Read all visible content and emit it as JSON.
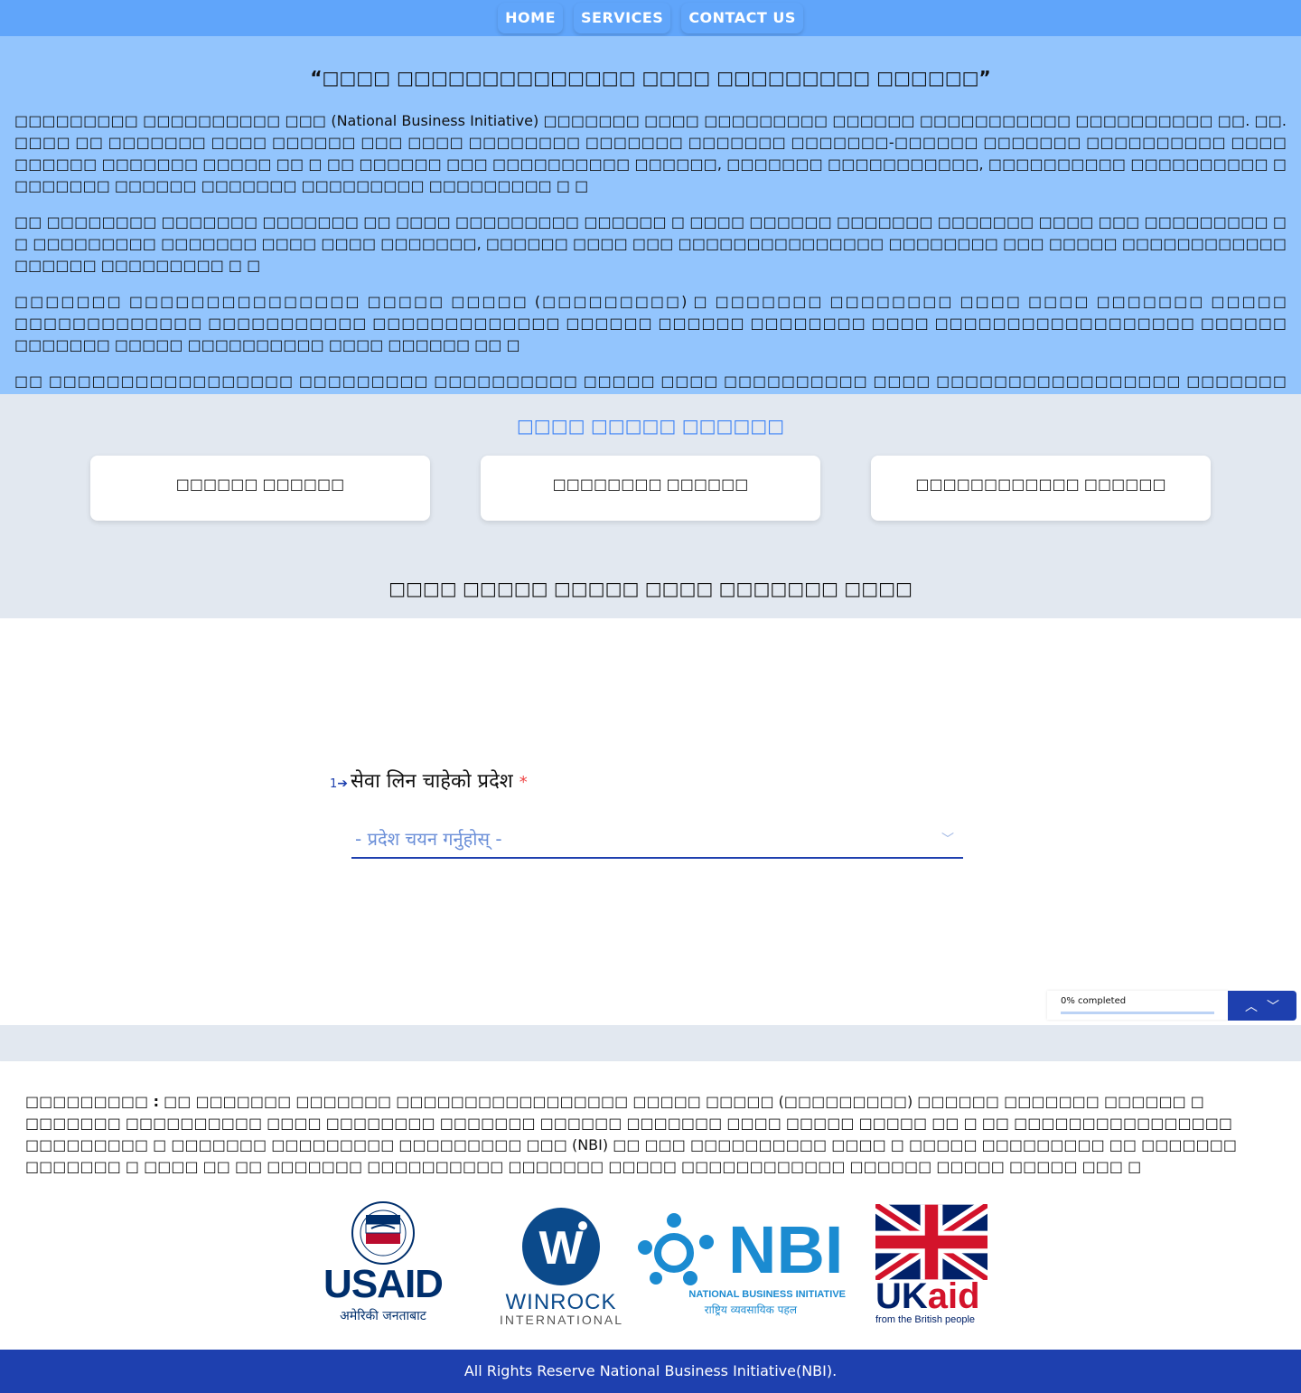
{
  "nav": {
    "home": "HOME",
    "services": "SERVICES",
    "contact": "CONTACT US"
  },
  "intro": {
    "heading": "“□□□□ □□□□□□□□□□□□□□ □□□□ □□□□□□□□□ □□□□□□”",
    "p1": "□□□□□□□□□ □□□□□□□□□□ □□□ (National Business Initiative) □□□□□□□ □□□□ □□□□□□□□□ □□□□□□ □□□□□□□□□□□ □□□□□□□□□□ □□. □□. □□□□ □□ □□□□□□□ □□□□ □□□□□□ □□□ □□□□ □□□□□□□□ □□□□□□□ □□□□□□□ □□□□□□□-□□□□□□ □□□□□□□ □□□□□□□□□□ □□□□ □□□□□□ □□□□□□□ □□□□□ □□ □ □□ □□□□□□ □□□ □□□□□□□□□□ □□□□□□, □□□□□□□ □□□□□□□□□□□, □□□□□□□□□□ □□□□□□□□□□ □ □□□□□□□ □□□□□□ □□□□□□□ □□□□□□□□□ □□□□□□□□□ □ □",
    "p2": "□□ □□□□□□□□ □□□□□□□ □□□□□□□ □□ □□□□ □□□□□□□□□ □□□□□□ □ □□□□ □□□□□□ □□□□□□□ □□□□□□□ □□□□ □□□ □□□□□□□□□ □ □ □□□□□□□□□ □□□□□□□ □□□□ □□□□ □□□□□□□, □□□□□□ □□□□ □□□ □□□□□□□□□□□□□□□ □□□□□□□□ □□□ □□□□□ □□□□□□□□□□□□ □□□□□□ □□□□□□□□□ □ □",
    "p3": "□□□□□□□ □□□□□□□□□□□□□□□ □□□□□ □□□□□ (□□□□□□□□□) □ □□□□□□□ □□□□□□□□ □□□□ □□□□ □□□□□□□ □□□□□ □□□□□□□□□□□□□ □□□□□□□□□□□ □□□□□□□□□□□□□ □□□□□□ □□□□□□ □□□□□□□□ □□□□ □□□□□□□□□□□□□□□□□□ □□□□□□ □□□□□□□ □□□□□ □□□□□□□□□□ □□□□ □□□□□□ □□ □",
    "p4": "□□ □□□□□□□□□□□□□□□□□ □□□□□□□□□ □□□□□□□□□□ □□□□□ □□□□ □□□□□□□□□□ □□□□ □□□□□□□□□□□□□□□□□ □□□□□□□ □□□□□□ □□□□□□□□□□□ □ □ □□□ □□□□□□ □□□□ □□□□□□□□□ □□□□ □□□□□□□ □□□□□□ □□□□□ □□□ □□□□□□ □□□□□□□□ □□□□ □ □□□□□ □□□□□□ □□□□□ □□□□□□□□□ □□□□□□ □□□□□□□□□□ □□□□□ □ □ □□□□□□□□□□□ □□□□□□ □□□□□□□□□□□ □□□□ □□□ □□□□□□□□ □□□□□ □□□□□□ □□□ □□□□□□□□□ □□□□□□□□□□ □□□□□ □□□□□□□□□□□□□□ □□□□□□□□□□□□□ □□□□□ □□□□□□□□□ □□□□□□ □ □"
  },
  "services": {
    "title": "□□□□ □□□□□ □□□□□□",
    "cards": [
      "□□□□□□ □□□□□□",
      "□□□□□□□□ □□□□□□",
      "□□□□□□□□□□□□ □□□□□□"
    ],
    "subtitle": "□□□□ □□□□□ □□□□□ □□□□ □□□□□□□ □□□□"
  },
  "form": {
    "question_number": "1",
    "question_label": "सेवा लिन चाहेको प्रदेश",
    "required_mark": "*",
    "select_placeholder": "- प्रदेश चयन गर्नुहोस् -",
    "progress_text": "0% completed",
    "progress_fraction": 0
  },
  "disclaimer": {
    "label": "□□□□□□□□□ :",
    "text": "□□ □□□□□□□ □□□□□□□ □□□□□□□□□□□□□□□□□ □□□□□ □□□□□ (□□□□□□□□□) □□□□□□ □□□□□□□ □□□□□□ □ □□□□□□□ □□□□□□□□□□ □□□□ □□□□□□□□ □□□□□□□ □□□□□□ □□□□□□□ □□□□ □□□□□ □□□□□ □□ □ □□ □□□□□□□□□□□□□□□□ □□□□□□□□□ □ □□□□□□□ □□□□□□□□□ □□□□□□□□□ □□□ (NBI) □□ □□□ □□□□□□□□□□ □□□□ □ □□□□□ □□□□□□□□□ □□ □□□□□□□ □□□□□□□ □ □□□□ □□ □□ □□□□□□□ □□□□□□□□□□ □□□□□□□ □□□□□ □□□□□□□□□□□□ □□□□□□ □□□□□ □□□□□ □□□ □"
  },
  "logos": {
    "usaid_word": "USAID",
    "usaid_tagline": "अमेरिकी जनताबाट",
    "winrock_word": "WINROCK",
    "winrock_sub": "INTERNATIONAL",
    "nbi_word": "NBI",
    "nbi_sub": "NATIONAL BUSINESS INITIATIVE",
    "nbi_tagline": "राष्ट्रिय व्यवसायिक पहल",
    "ukaid_word_uk": "UK",
    "ukaid_word_aid": "aid",
    "ukaid_tagline": "from the British people",
    "colors": {
      "usaid_blue": "#002f6c",
      "usaid_red": "#ba0c2f",
      "winrock_blue": "#0b4a8b",
      "nbi_blue": "#1b8bd1",
      "ukaid_red": "#d3132b"
    }
  },
  "footer": {
    "text": "All Rights Reserve National Business Initiative(NBI)."
  }
}
